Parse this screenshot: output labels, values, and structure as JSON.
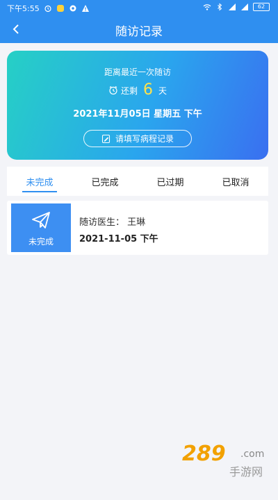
{
  "status_bar": {
    "time": "下午5:55",
    "battery": "62"
  },
  "nav": {
    "title": "随访记录"
  },
  "summary": {
    "heading": "距离最近一次随访",
    "remain_prefix": "还剩",
    "remain_days": "6",
    "remain_suffix": "天",
    "date": "2021年11月05日 星期五 下午",
    "action_label": "请填写病程记录"
  },
  "tabs": [
    {
      "label": "未完成",
      "active": true
    },
    {
      "label": "已完成",
      "active": false
    },
    {
      "label": "已过期",
      "active": false
    },
    {
      "label": "已取消",
      "active": false
    }
  ],
  "records": [
    {
      "status": "未完成",
      "doctor": "随访医生：  王琳",
      "date": "2021-11-05  下午"
    }
  ],
  "watermark": {
    "logo": "289",
    "suffix": ".com",
    "cn": "手游网"
  },
  "colors": {
    "primary": "#2f8ff0",
    "highlight": "#ffe24a"
  }
}
